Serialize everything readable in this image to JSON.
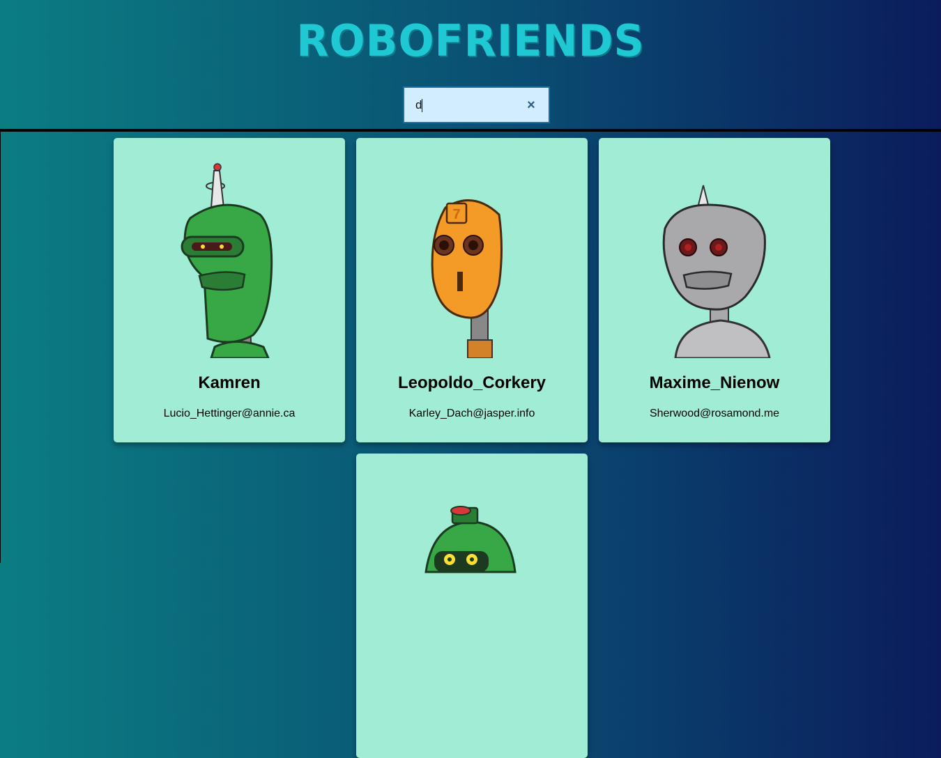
{
  "app": {
    "title": "RoboFriends"
  },
  "search": {
    "value": "d",
    "clear_label": "×"
  },
  "robots": [
    {
      "name": "Kamren",
      "email": "Lucio_Hettinger@annie.ca",
      "color": "#37a845"
    },
    {
      "name": "Leopoldo_Corkery",
      "email": "Karley_Dach@jasper.info",
      "color": "#f49a26"
    },
    {
      "name": "Maxime_Nienow",
      "email": "Sherwood@rosamond.me",
      "color": "#a9a9ab"
    },
    {
      "name": "",
      "email": "",
      "color": "#37a845"
    }
  ]
}
